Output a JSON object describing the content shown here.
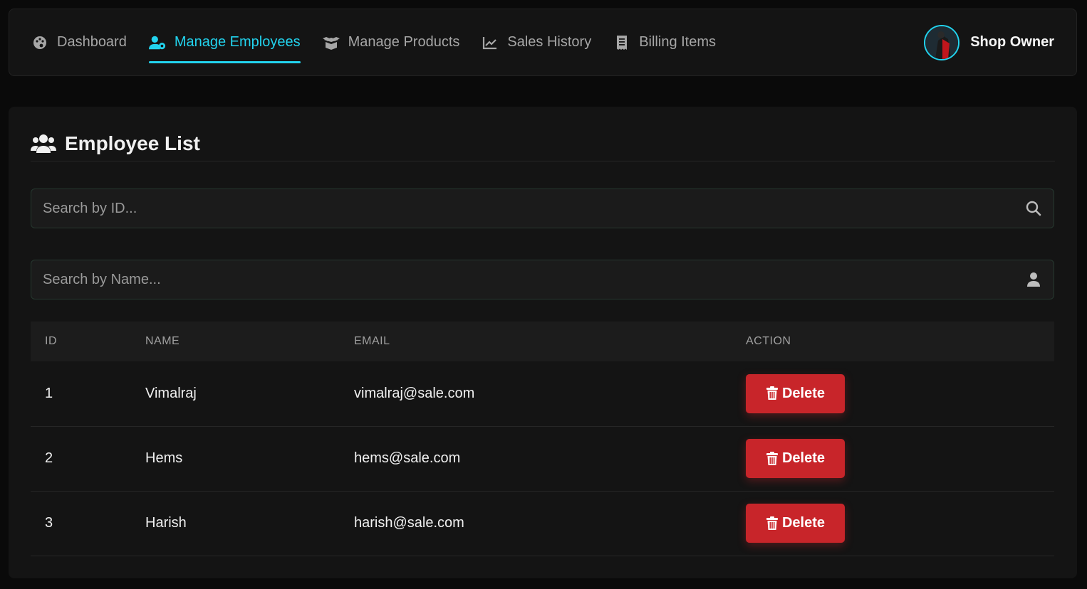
{
  "nav": {
    "items": [
      {
        "label": "Dashboard",
        "icon": "palette-icon",
        "active": false
      },
      {
        "label": "Manage Employees",
        "icon": "user-gear-icon",
        "active": true
      },
      {
        "label": "Manage Products",
        "icon": "box-open-icon",
        "active": false
      },
      {
        "label": "Sales History",
        "icon": "chart-line-icon",
        "active": false
      },
      {
        "label": "Billing Items",
        "icon": "receipt-icon",
        "active": false
      }
    ],
    "profile_name": "Shop Owner"
  },
  "panel": {
    "title": "Employee List",
    "title_icon": "users-icon"
  },
  "search_id": {
    "placeholder": "Search by ID...",
    "value": "",
    "icon": "search-icon"
  },
  "search_name": {
    "placeholder": "Search by Name...",
    "value": "",
    "icon": "user-icon"
  },
  "table": {
    "headers": [
      "ID",
      "NAME",
      "EMAIL",
      "ACTION"
    ],
    "rows": [
      {
        "id": "1",
        "name": "Vimalraj",
        "email": "vimalraj@sale.com",
        "action": "Delete"
      },
      {
        "id": "2",
        "name": "Hems",
        "email": "hems@sale.com",
        "action": "Delete"
      },
      {
        "id": "3",
        "name": "Harish",
        "email": "harish@sale.com",
        "action": "Delete"
      }
    ]
  },
  "colors": {
    "accent": "#22d3ee",
    "danger": "#c8252a",
    "background": "#0a0a0a",
    "panel": "#141414"
  }
}
